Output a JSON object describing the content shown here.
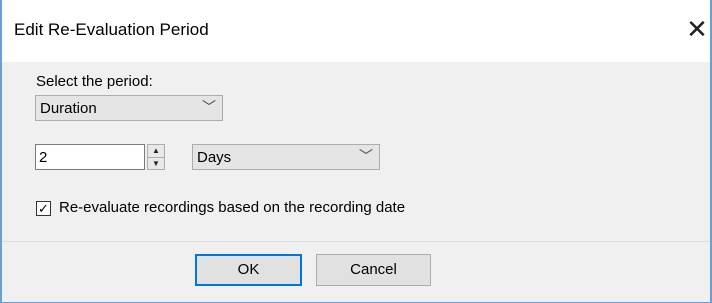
{
  "window": {
    "title": "Edit Re-Evaluation Period",
    "close_glyph": "✕"
  },
  "period": {
    "label": "Select the period:",
    "selected": "Duration",
    "arrow_glyph": "﹀"
  },
  "duration": {
    "value": "2",
    "unit": "Days",
    "spin_up": "▲",
    "spin_down": "▼"
  },
  "recording_date_option": {
    "label": "Re-evaluate recordings based on the recording date",
    "checked": true,
    "check_glyph": "✓"
  },
  "buttons": {
    "ok": "OK",
    "cancel": "Cancel"
  }
}
